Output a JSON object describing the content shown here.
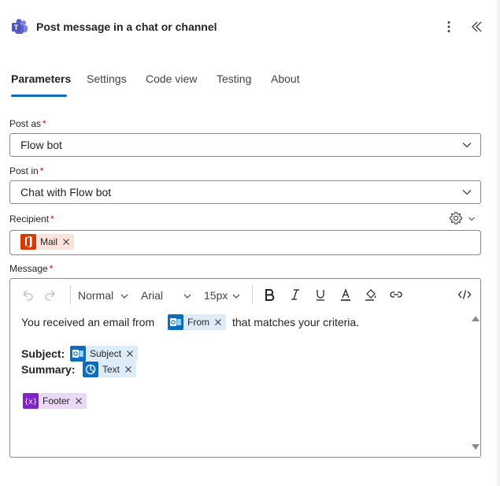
{
  "header": {
    "title": "Post message in a chat or channel",
    "more_icon": "more-vertical-icon",
    "collapse_icon": "double-chevron-left-icon"
  },
  "tabs": [
    {
      "label": "Parameters",
      "active": true
    },
    {
      "label": "Settings"
    },
    {
      "label": "Code view"
    },
    {
      "label": "Testing"
    },
    {
      "label": "About"
    }
  ],
  "fields": {
    "post_as": {
      "label": "Post as",
      "required": "*",
      "value": "Flow bot"
    },
    "post_in": {
      "label": "Post in",
      "required": "*",
      "value": "Chat with Flow bot"
    },
    "recipient": {
      "label": "Recipient",
      "required": "*",
      "token": "Mail"
    },
    "message": {
      "label": "Message",
      "required": "*"
    }
  },
  "editor": {
    "format": "Normal",
    "font": "Arial",
    "size": "15px",
    "line1_prefix": "You received an email from",
    "line1_token": "From",
    "line1_suffix": "that matches your criteria.",
    "subject_label": "Subject",
    "subject_token": "Subject",
    "summary_label": "Summary",
    "summary_token": "Text",
    "footer_token": "Footer",
    "colon": ":"
  },
  "colors": {
    "accent": "#0f6cbd",
    "outlook_blue": "#0f6cbd",
    "office_red": "#d83b01",
    "variable_purple": "#7e25c7",
    "teams_purple": "#5b5fc7"
  }
}
